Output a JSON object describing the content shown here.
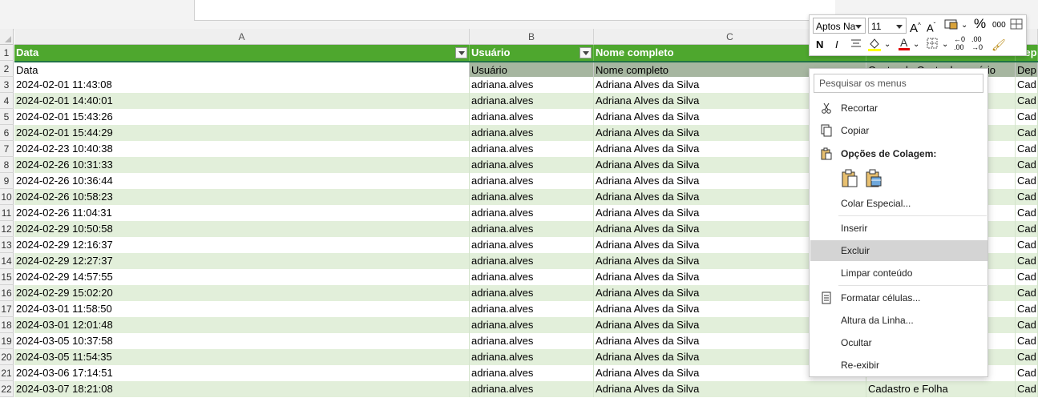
{
  "columns": [
    {
      "letter": "A"
    },
    {
      "letter": "B"
    },
    {
      "letter": "C"
    }
  ],
  "header_row": {
    "number": "1",
    "cells": [
      "Data",
      "Usuário",
      "Nome completo",
      "Dep"
    ]
  },
  "sub_row": {
    "number": "2",
    "cells": [
      "Data",
      "Usuário",
      "Nome completo",
      "Centro de Custo do usuário",
      "Dep"
    ]
  },
  "rows": [
    {
      "n": "3",
      "date": "2024-02-01 11:43:08",
      "user": "adriana.alves",
      "name": "Adriana Alves da Silva",
      "dep": "Cad"
    },
    {
      "n": "4",
      "date": "2024-02-01 14:40:01",
      "user": "adriana.alves",
      "name": "Adriana Alves da Silva",
      "dep": "Cad"
    },
    {
      "n": "5",
      "date": "2024-02-01 15:43:26",
      "user": "adriana.alves",
      "name": "Adriana Alves da Silva",
      "dep": "Cad"
    },
    {
      "n": "6",
      "date": "2024-02-01 15:44:29",
      "user": "adriana.alves",
      "name": "Adriana Alves da Silva",
      "dep": "Cad"
    },
    {
      "n": "7",
      "date": "2024-02-23 10:40:38",
      "user": "adriana.alves",
      "name": "Adriana Alves da Silva",
      "dep": "Cad"
    },
    {
      "n": "8",
      "date": "2024-02-26 10:31:33",
      "user": "adriana.alves",
      "name": "Adriana Alves da Silva",
      "dep": "Cad"
    },
    {
      "n": "9",
      "date": "2024-02-26 10:36:44",
      "user": "adriana.alves",
      "name": "Adriana Alves da Silva",
      "dep": "Cad"
    },
    {
      "n": "10",
      "date": "2024-02-26 10:58:23",
      "user": "adriana.alves",
      "name": "Adriana Alves da Silva",
      "dep": "Cad"
    },
    {
      "n": "11",
      "date": "2024-02-26 11:04:31",
      "user": "adriana.alves",
      "name": "Adriana Alves da Silva",
      "dep": "Cad"
    },
    {
      "n": "12",
      "date": "2024-02-29 10:50:58",
      "user": "adriana.alves",
      "name": "Adriana Alves da Silva",
      "dep": "Cad"
    },
    {
      "n": "13",
      "date": "2024-02-29 12:16:37",
      "user": "adriana.alves",
      "name": "Adriana Alves da Silva",
      "dep": "Cad"
    },
    {
      "n": "14",
      "date": "2024-02-29 12:27:37",
      "user": "adriana.alves",
      "name": "Adriana Alves da Silva",
      "dep": "Cad"
    },
    {
      "n": "15",
      "date": "2024-02-29 14:57:55",
      "user": "adriana.alves",
      "name": "Adriana Alves da Silva",
      "dep": "Cad"
    },
    {
      "n": "16",
      "date": "2024-02-29 15:02:20",
      "user": "adriana.alves",
      "name": "Adriana Alves da Silva",
      "dep": "Cad"
    },
    {
      "n": "17",
      "date": "2024-03-01 11:58:50",
      "user": "adriana.alves",
      "name": "Adriana Alves da Silva",
      "dep": "Cad"
    },
    {
      "n": "18",
      "date": "2024-03-01 12:01:48",
      "user": "adriana.alves",
      "name": "Adriana Alves da Silva",
      "dep": "Cad"
    },
    {
      "n": "19",
      "date": "2024-03-05 10:37:58",
      "user": "adriana.alves",
      "name": "Adriana Alves da Silva",
      "dep": "Cad"
    },
    {
      "n": "20",
      "date": "2024-03-05 11:54:35",
      "user": "adriana.alves",
      "name": "Adriana Alves da Silva",
      "dep": "Cad"
    },
    {
      "n": "21",
      "date": "2024-03-06 17:14:51",
      "user": "adriana.alves",
      "name": "Adriana Alves da Silva",
      "dep": "Cad"
    },
    {
      "n": "22",
      "date": "2024-03-07 18:21:08",
      "user": "adriana.alves",
      "name": "Adriana Alves da Silva",
      "cost_center": "Cadastro e Folha",
      "dep": "Cad"
    }
  ],
  "mini_toolbar": {
    "font_name": "Aptos Na",
    "font_size": "11",
    "bold": "N",
    "italic": "I",
    "percent": "%",
    "thousands": "000"
  },
  "context_menu": {
    "search_placeholder": "Pesquisar os menus",
    "cut": "Recortar",
    "copy": "Copiar",
    "paste_options": "Opções de Colagem:",
    "paste_special": "Colar Especial...",
    "insert": "Inserir",
    "delete": "Excluir",
    "clear_contents": "Limpar conteúdo",
    "format_cells": "Formatar células...",
    "row_height": "Altura da Linha...",
    "hide": "Ocultar",
    "unhide": "Re-exibir"
  },
  "colors": {
    "header_green": "#4ea72e",
    "band_green": "#e2efda",
    "sub_header_gray": "#a6b6a0",
    "font_color_red": "#e00000",
    "highlight_yellow": "#ffff00"
  }
}
